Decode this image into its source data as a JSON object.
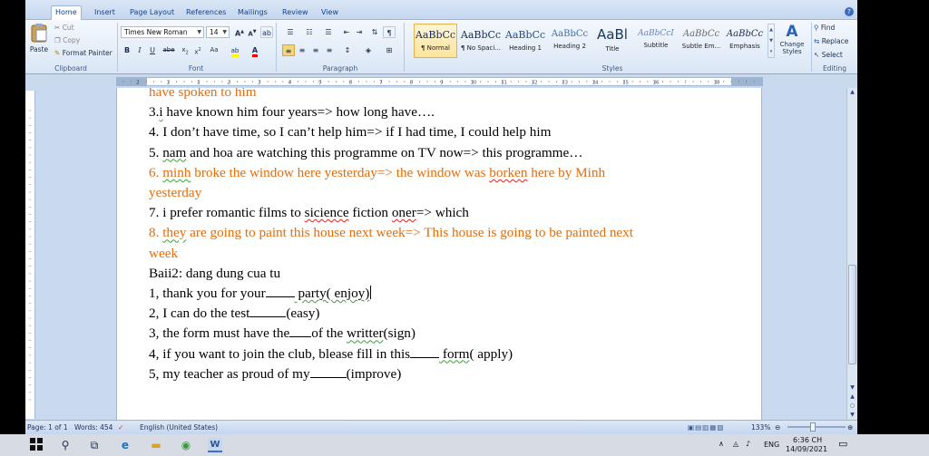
{
  "ribbon": {
    "tabs": [
      "Home",
      "Insert",
      "Page Layout",
      "References",
      "Mailings",
      "Review",
      "View"
    ],
    "clipboard": {
      "paste": "Paste",
      "cut": "Cut",
      "copy": "Copy",
      "format_painter": "Format Painter",
      "label": "Clipboard"
    },
    "font": {
      "name": "Times New Roman",
      "size": "14",
      "label": "Font"
    },
    "paragraph_label": "Paragraph",
    "styles": [
      {
        "sample": "AaBbCc",
        "name": "¶ Normal"
      },
      {
        "sample": "AaBbCc",
        "name": "¶ No Spaci..."
      },
      {
        "sample": "AaBbCc",
        "name": "Heading 1"
      },
      {
        "sample": "AaBbCc",
        "name": "Heading 2"
      },
      {
        "sample": "AaBl",
        "name": "Title"
      },
      {
        "sample": "AaBbCcI",
        "name": "Subtitle"
      },
      {
        "sample": "AaBbCc",
        "name": "Subtle Em..."
      },
      {
        "sample": "AaBbCc",
        "name": "Emphasis"
      }
    ],
    "change_styles": "Change Styles",
    "styles_label": "Styles",
    "editing": {
      "find": "Find",
      "replace": "Replace",
      "select": "Select",
      "label": "Editing"
    }
  },
  "ruler_numbers": [
    "2",
    "1",
    "1",
    "2",
    "3",
    "4",
    "5",
    "6",
    "7",
    "8",
    "9",
    "10",
    "11",
    "12",
    "13",
    "14",
    "15",
    "16",
    "18"
  ],
  "document": {
    "l0": "have spoken to him",
    "l1_pre": "3.",
    "l1_i": "i",
    "l1_post": " have known him four years=> how long have….",
    "l2": "4. I don’t have time, so I can’t help him=> if I had time, I could help him",
    "l3_pre": "5. ",
    "l3_nam": "nam",
    "l3_post": " and hoa are watching this programme on TV now=> this programme…",
    "l4_pre": "6. ",
    "l4_minh": "minh",
    "l4_mid": " broke the window here yesterday=> the window was ",
    "l4_borken": "borken",
    "l4_post": " here by Minh",
    "l5": "yesterday",
    "l6_pre": "7. i prefer romantic films to ",
    "l6_sicience": "sicience",
    "l6_mid": " fiction ",
    "l6_oner": "oner",
    "l6_post": "=> which",
    "l7_pre": "8. ",
    "l7_they": "they",
    "l7_post": " are going to paint this house next week=> This house is going to be painted next",
    "l8": "week",
    "l9_pre": "Baii2: ",
    "l9_post": "dang dung cua tu",
    "l10_pre": "1, thank you for your",
    "l10_post": " party( enjoy)",
    "l11_pre": "2, I can do the test",
    "l11_post": "(easy)",
    "l12_pre": "3, the form must have the",
    "l12_mid": "of the ",
    "l12_writter": "writter",
    "l12_post": "(sign)",
    "l13_pre": "4, if you want to join the club, blease fill in this",
    "l13_form": " form",
    "l13_post": "( apply)",
    "l14_pre": "5, my teacher as proud of my",
    "l14_post": "(improve)"
  },
  "status": {
    "page": "Page: 1 of 1",
    "words": "Words: 454",
    "language": "English (United States)",
    "zoom": "133%"
  },
  "taskbar": {
    "lang": "ENG",
    "time": "6:36 CH",
    "date": "14/09/2021"
  }
}
